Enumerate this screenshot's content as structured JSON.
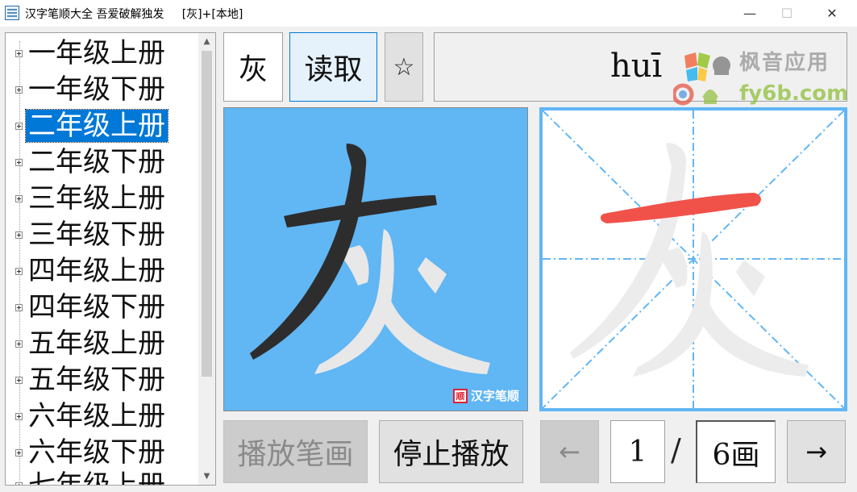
{
  "window": {
    "title": "汉字笔顺大全 吾爱破解独发     [灰]+[本地]",
    "minimize_glyph": "—",
    "maximize_glyph": "☐",
    "close_glyph": "✕"
  },
  "tree": {
    "items": [
      {
        "label": "一年级上册",
        "selected": false
      },
      {
        "label": "一年级下册",
        "selected": false
      },
      {
        "label": "二年级上册",
        "selected": true
      },
      {
        "label": "二年级下册",
        "selected": false
      },
      {
        "label": "三年级上册",
        "selected": false
      },
      {
        "label": "三年级下册",
        "selected": false
      },
      {
        "label": "四年级上册",
        "selected": false
      },
      {
        "label": "四年级下册",
        "selected": false
      },
      {
        "label": "五年级上册",
        "selected": false
      },
      {
        "label": "五年级下册",
        "selected": false
      },
      {
        "label": "六年级上册",
        "selected": false
      },
      {
        "label": "六年级下册",
        "selected": false
      },
      {
        "label": "七年级上册",
        "selected": false
      }
    ],
    "scroll_up_glyph": "▲",
    "scroll_down_glyph": "▼"
  },
  "controls": {
    "character": "灰",
    "read_label": "读取",
    "favorite_glyph": "☆",
    "pinyin": "huī"
  },
  "watermark": {
    "line1": "枫音应用",
    "line2": "fy6b.com"
  },
  "stroke_animation": {
    "brand": "汉字笔顺",
    "brand_icon_char": "顺"
  },
  "player": {
    "play_label": "播放笔画",
    "stop_label": "停止播放",
    "prev_glyph": "←",
    "next_glyph": "→",
    "current_stroke": "1",
    "separator": "/",
    "total_strokes": "6画"
  },
  "colors": {
    "accent": "#0078d7",
    "panel_blue": "#61b6f4",
    "stroke_dark": "#2d2d2d",
    "stroke_ghost": "#e8e8e8",
    "stroke_highlight": "#f0524a",
    "guide_line": "#61b6f4"
  }
}
